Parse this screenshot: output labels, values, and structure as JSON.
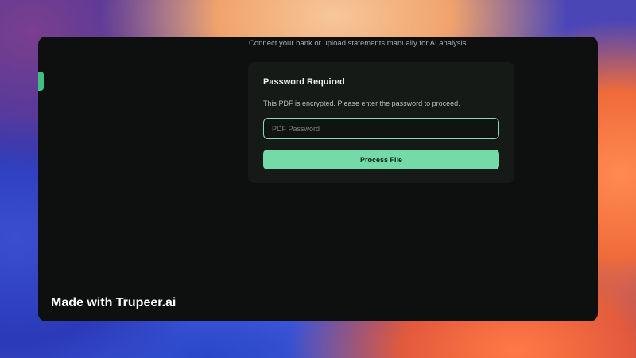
{
  "header": {
    "subtitle": "Connect your bank or upload statements manually for AI analysis."
  },
  "password_card": {
    "title": "Password Required",
    "description": "This PDF is encrypted. Please enter the password to proceed.",
    "input_placeholder": "PDF Password",
    "input_value": "",
    "submit_label": "Process File"
  },
  "watermark": {
    "text": "Made with Trupeer.ai"
  },
  "colors": {
    "accent": "#74dba8",
    "input_border": "#8fd6b2",
    "window_bg": "#0d100e",
    "card_bg": "#161a17"
  }
}
